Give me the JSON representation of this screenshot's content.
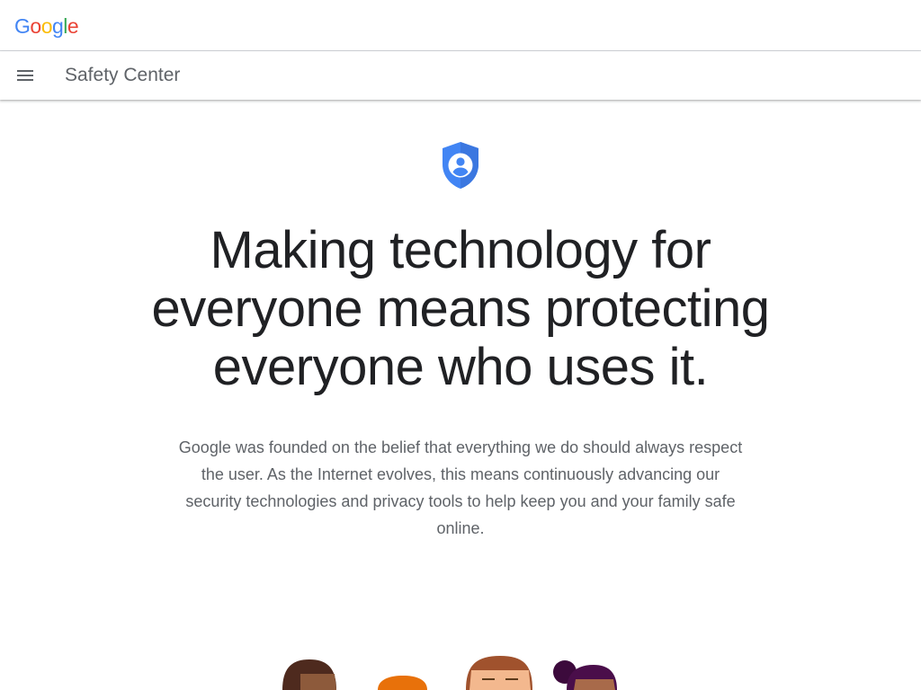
{
  "header": {
    "logo_letters": [
      {
        "char": "G",
        "color": "#4285F4"
      },
      {
        "char": "o",
        "color": "#EA4335"
      },
      {
        "char": "o",
        "color": "#FBBC05"
      },
      {
        "char": "g",
        "color": "#4285F4"
      },
      {
        "char": "l",
        "color": "#34A853"
      },
      {
        "char": "e",
        "color": "#EA4335"
      }
    ]
  },
  "nav": {
    "menu_icon": "hamburger-menu-icon",
    "title": "Safety Center"
  },
  "hero": {
    "icon": "shield-person-icon",
    "icon_color": "#4285F4",
    "headline": "Making technology for everyone means protecting everyone who uses it.",
    "intro": "Google was founded on the belief that everything we do should always respect the user. As the Internet evolves, this means continuously advancing our security technologies and privacy tools to help keep you and your family safe online."
  }
}
